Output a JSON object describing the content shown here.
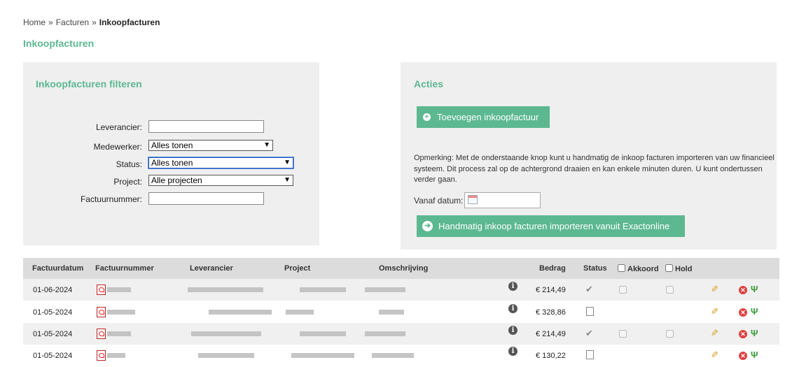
{
  "breadcrumb": {
    "home": "Home",
    "sep1": "»",
    "facturen": "Facturen",
    "sep2": "»",
    "current": "Inkoopfacturen"
  },
  "page_title": "Inkoopfacturen",
  "filter": {
    "title": "Inkoopfacturen filteren",
    "leverancier": {
      "label": "Leverancier:",
      "value": ""
    },
    "medewerker": {
      "label": "Medewerker:",
      "value": "Alles tonen"
    },
    "status": {
      "label": "Status:",
      "value": "Alles tonen"
    },
    "project": {
      "label": "Project:",
      "value": "Alle projecten"
    },
    "factuurnummer": {
      "label": "Factuurnummer:",
      "value": ""
    }
  },
  "actions": {
    "title": "Acties",
    "add_button": "Toevoegen inkoopfactuur",
    "remark": "Opmerking: Met de onderstaande knop kunt u handmatig de inkoop facturen importeren van uw financieel systeem. Dit process zal op de achtergrond draaien en kan enkele minuten duren. U kunt ondertussen verder gaan.",
    "date_label": "Vanaf datum:",
    "date_value": "",
    "import_button": "Handmatig inkoop facturen importeren vanuit Exactonline"
  },
  "table": {
    "columns": {
      "factuurdatum": "Factuurdatum",
      "factuurnummer": "Factuurnummer",
      "leverancier": "Leverancier",
      "project": "Project",
      "omschrijving": "Omschrijving",
      "bedrag": "Bedrag",
      "status": "Status",
      "akkoord": "Akkoord",
      "hold": "Hold"
    },
    "rows": [
      {
        "date": "01-06-2024",
        "amount": "€ 214,49",
        "status": "approved"
      },
      {
        "date": "01-05-2024",
        "amount": "€ 328,86",
        "status": "document"
      },
      {
        "date": "01-05-2024",
        "amount": "€ 214,49",
        "status": "approved"
      },
      {
        "date": "01-05-2024",
        "amount": "€ 130,22",
        "status": "document"
      }
    ]
  },
  "colors": {
    "accent": "#5cb891",
    "panel": "#efefef",
    "header": "#dcdcdc",
    "alt_row": "#f0f0f0"
  },
  "icons": [
    "pdf-icon",
    "info-icon",
    "check-icon",
    "document-icon",
    "pencil-icon",
    "delete-icon",
    "split-icon",
    "calendar-icon",
    "plus-icon",
    "arrow-right-icon"
  ]
}
